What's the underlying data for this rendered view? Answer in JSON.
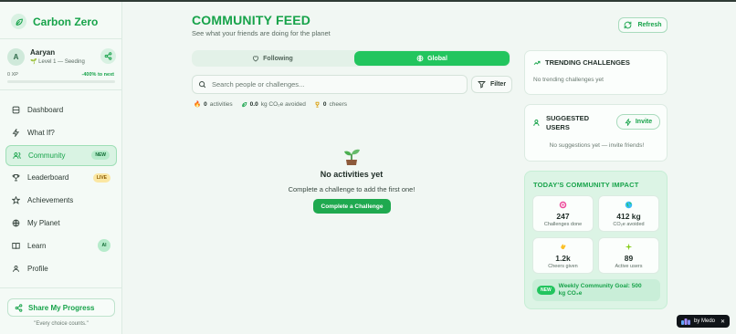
{
  "app": {
    "name": "Carbon Zero"
  },
  "user": {
    "avatar_letter": "A",
    "name": "Aaryan",
    "level_text": "Level 1 — Seeding",
    "xp_text": "0 XP",
    "next_text": "-400% to next",
    "xp_progress": 0
  },
  "nav": {
    "items": [
      {
        "label": "Dashboard",
        "icon": "dashboard-icon"
      },
      {
        "label": "What If?",
        "icon": "bolt-icon"
      },
      {
        "label": "Community",
        "icon": "users-icon",
        "badge": "NEW",
        "active": true
      },
      {
        "label": "Leaderboard",
        "icon": "trophy-icon",
        "badge": "LIVE"
      },
      {
        "label": "Achievements",
        "icon": "star-icon"
      },
      {
        "label": "My Planet",
        "icon": "globe-icon"
      },
      {
        "label": "Learn",
        "icon": "book-icon",
        "badge": "AI"
      },
      {
        "label": "Profile",
        "icon": "user-icon"
      }
    ]
  },
  "sidebar_footer": {
    "share_label": "Share My Progress",
    "quote": "\"Every choice counts.\""
  },
  "header": {
    "title": "COMMUNITY FEED",
    "subtitle": "See what your friends are doing for the planet",
    "refresh_label": "Refresh"
  },
  "feed_toggle": {
    "following": "Following",
    "global": "Global",
    "selected": "global"
  },
  "search": {
    "placeholder": "Search people or challenges...",
    "value": "",
    "filter_label": "Filter"
  },
  "stats": {
    "activities_count": "0",
    "activities_label": "activities",
    "co2_value": "0.0",
    "co2_label": "kg CO₂e avoided",
    "cheers_count": "0",
    "cheers_label": "cheers"
  },
  "empty_state": {
    "title": "No activities yet",
    "subtitle": "Complete a challenge to add the first one!",
    "cta_label": "Complete a Challenge"
  },
  "trending": {
    "title": "TRENDING CHALLENGES",
    "empty": "No trending challenges yet"
  },
  "suggested": {
    "title_line1": "SUGGESTED",
    "title_line2": "USERS",
    "invite_label": "Invite",
    "empty": "No suggestions yet — invite friends!"
  },
  "impact": {
    "title": "TODAY'S COMMUNITY IMPACT",
    "tiles": [
      {
        "value": "247",
        "label": "Challenges done",
        "icon": "target-icon"
      },
      {
        "value": "412 kg",
        "label": "CO₂e avoided",
        "icon": "earth-icon"
      },
      {
        "value": "1.2k",
        "label": "Cheers given",
        "icon": "clap-icon"
      },
      {
        "value": "89",
        "label": "Active users",
        "icon": "sparkle-icon"
      }
    ],
    "goal_badge": "NEW",
    "goal_line1": "Weekly Community Goal: 500",
    "goal_line2": "kg CO₂e"
  },
  "medo": {
    "label": "by Medo",
    "close": "✕"
  },
  "colors": {
    "accent": "#17a34a",
    "accent_bright": "#22c55e",
    "bg": "#f1f7f3"
  }
}
